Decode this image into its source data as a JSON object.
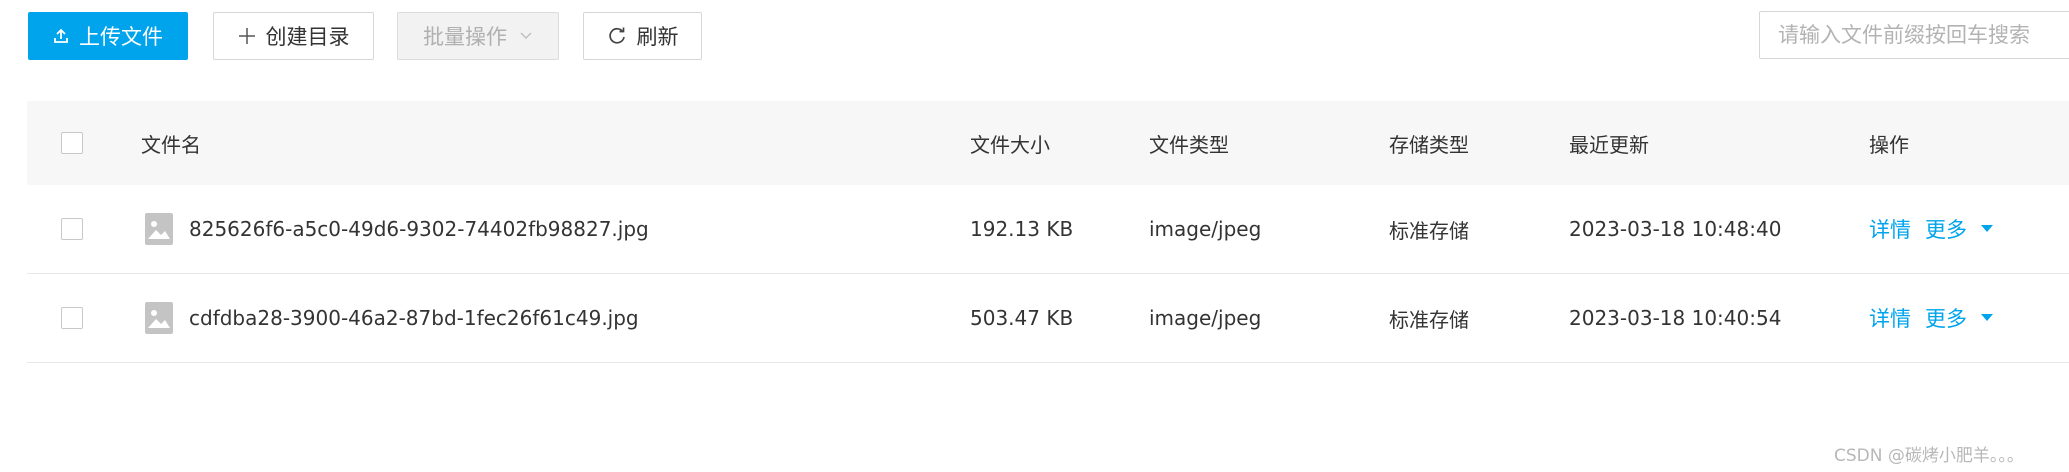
{
  "toolbar": {
    "upload_label": "上传文件",
    "mkdir_label": "创建目录",
    "batch_label": "批量操作",
    "refresh_label": "刷新",
    "search_placeholder": "请输入文件前缀按回车搜索",
    "search_value": ""
  },
  "table": {
    "columns": {
      "name": "文件名",
      "size": "文件大小",
      "type": "文件类型",
      "storage": "存储类型",
      "updated": "最近更新",
      "actions": "操作"
    },
    "rows": [
      {
        "name": "825626f6-a5c0-49d6-9302-74402fb98827.jpg",
        "size": "192.13 KB",
        "type": "image/jpeg",
        "storage": "标准存储",
        "updated": "2023-03-18 10:48:40",
        "detail_label": "详情",
        "more_label": "更多"
      },
      {
        "name": "cdfdba28-3900-46a2-87bd-1fec26f61c49.jpg",
        "size": "503.47 KB",
        "type": "image/jpeg",
        "storage": "标准存储",
        "updated": "2023-03-18 10:40:54",
        "detail_label": "详情",
        "more_label": "更多"
      }
    ]
  },
  "watermark": "CSDN @碳烤小肥羊。。。",
  "colors": {
    "accent": "#00a4ec",
    "header_bg": "#f7f7f7",
    "disabled_bg": "#f2f2f2",
    "text": "#333333",
    "muted": "#b3b3b3"
  },
  "icons": [
    "upload-icon",
    "plus-icon",
    "chevron-down-icon",
    "refresh-icon",
    "image-file-icon",
    "caret-down-icon"
  ]
}
